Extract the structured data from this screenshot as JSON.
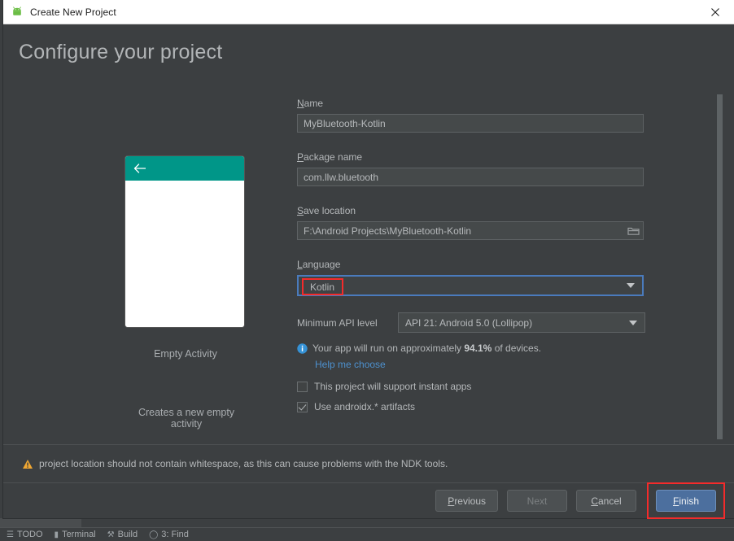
{
  "window": {
    "title": "Create New Project",
    "app_icon": "android-robot-icon",
    "close_icon": "close-icon"
  },
  "heading": "Configure your project",
  "preview": {
    "back_arrow_icon": "back-arrow-icon",
    "template_name": "Empty Activity",
    "template_description": "Creates a new empty activity",
    "appbar_color": "#009688"
  },
  "form": {
    "name": {
      "label_prefix": "",
      "label_mnemonic": "N",
      "label_suffix": "ame",
      "label": "Name",
      "value": "MyBluetooth-Kotlin"
    },
    "package_name": {
      "label_mnemonic": "P",
      "label_suffix": "ackage name",
      "label": "Package name",
      "value": "com.llw.bluetooth"
    },
    "save_location": {
      "label_mnemonic": "S",
      "label_suffix": "ave location",
      "label": "Save location",
      "value": "F:\\Android Projects\\MyBluetooth-Kotlin",
      "browse_icon": "folder-icon"
    },
    "language": {
      "label_mnemonic": "L",
      "label_suffix": "anguage",
      "label": "Language",
      "value": "Kotlin",
      "arrow_icon": "chevron-down-icon",
      "focused": true,
      "highlight_color": "#f42b2b"
    },
    "minimum_api_level": {
      "label": "Minimum API level",
      "value": "API 21: Android 5.0 (Lollipop)",
      "arrow_icon": "chevron-down-icon"
    },
    "device_info": {
      "icon": "info-icon",
      "text_before": "Your app will run on approximately ",
      "percent": "94.1%",
      "text_after": " of devices.",
      "help_link": "Help me choose",
      "link_color": "#4d90cd"
    },
    "checkboxes": [
      {
        "label": "This project will support instant apps",
        "checked": false
      },
      {
        "label": "Use androidx.* artifacts",
        "checked": true
      }
    ]
  },
  "warning": {
    "icon": "warning-triangle-icon",
    "text": "project location should not contain whitespace, as this can cause problems with the NDK tools.",
    "icon_color": "#f0a732"
  },
  "buttons": {
    "previous": {
      "mnemonic": "P",
      "rest": "revious",
      "label": "Previous",
      "disabled": false
    },
    "next": {
      "label": "Next",
      "disabled": true
    },
    "cancel": {
      "mnemonic": "C",
      "rest": "ancel",
      "label": "Cancel",
      "disabled": false
    },
    "finish": {
      "mnemonic": "F",
      "rest": "inish",
      "label": "Finish",
      "primary": true,
      "highlight_color": "#f42b2b",
      "accent_color": "#4c6f9e"
    }
  },
  "ide_background": {
    "tools": [
      {
        "icon": "todo-icon",
        "label": "TODO"
      },
      {
        "icon": "terminal-icon",
        "label": "Terminal"
      },
      {
        "icon": "build-icon",
        "label": "Build"
      },
      {
        "icon": "find-icon",
        "label": "3: Find"
      }
    ]
  }
}
